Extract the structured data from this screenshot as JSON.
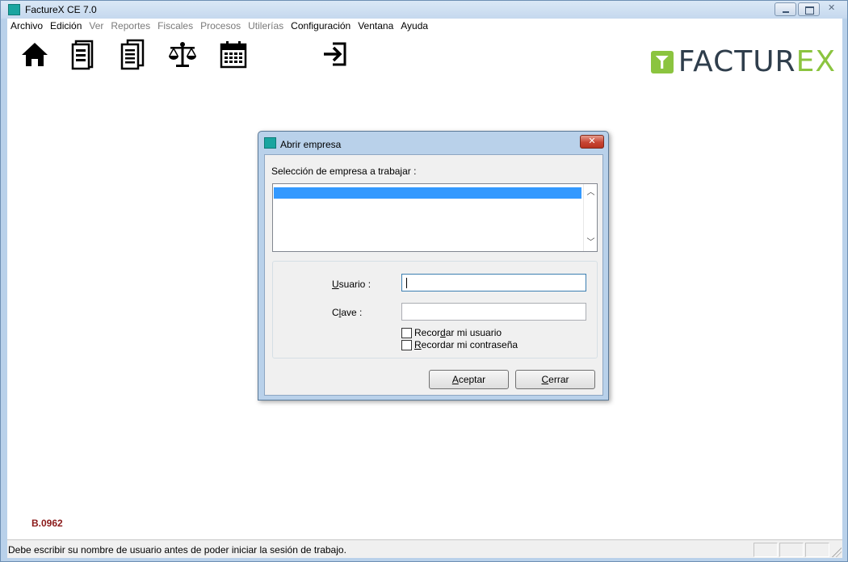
{
  "window": {
    "title": "FactureX CE 7.0"
  },
  "menu": [
    {
      "label": "Archivo",
      "enabled": true
    },
    {
      "label": "Edición",
      "enabled": true
    },
    {
      "label": "Ver",
      "enabled": false
    },
    {
      "label": "Reportes",
      "enabled": false
    },
    {
      "label": "Fiscales",
      "enabled": false
    },
    {
      "label": "Procesos",
      "enabled": false
    },
    {
      "label": "Utilerías",
      "enabled": false
    },
    {
      "label": "Configuración",
      "enabled": true
    },
    {
      "label": "Ventana",
      "enabled": true
    },
    {
      "label": "Ayuda",
      "enabled": true
    }
  ],
  "toolbar": {
    "buttons": [
      {
        "icon": "home-icon"
      },
      {
        "icon": "document-icon"
      },
      {
        "icon": "documents-icon"
      },
      {
        "icon": "scales-icon"
      },
      {
        "icon": "calendar-icon"
      },
      {
        "icon": "sign-in-icon"
      }
    ]
  },
  "logo": {
    "text_main": "FACTUR",
    "text_accent": "EX",
    "accent_color": "#8bc43f"
  },
  "build": "B.0962",
  "dialog": {
    "title": "Abrir empresa",
    "list_label": "Selección de empresa a trabajar :",
    "list_items": [
      ""
    ],
    "usuario": {
      "label_access": "U",
      "label_rest": "suario :",
      "value": ""
    },
    "clave": {
      "label_pre": "C",
      "label_access": "l",
      "label_rest": "ave :",
      "value": ""
    },
    "remember_user": {
      "pre": "Recor",
      "access": "d",
      "rest": "ar mi usuario",
      "checked": false
    },
    "remember_pass": {
      "pre": "",
      "access": "R",
      "rest": "ecordar mi contraseña",
      "checked": false
    },
    "accept": {
      "access": "A",
      "rest": "ceptar"
    },
    "close": {
      "access": "C",
      "rest": "errar"
    }
  },
  "status": {
    "message": "Debe escribir su nombre de usuario antes de poder iniciar la sesión de trabajo."
  }
}
